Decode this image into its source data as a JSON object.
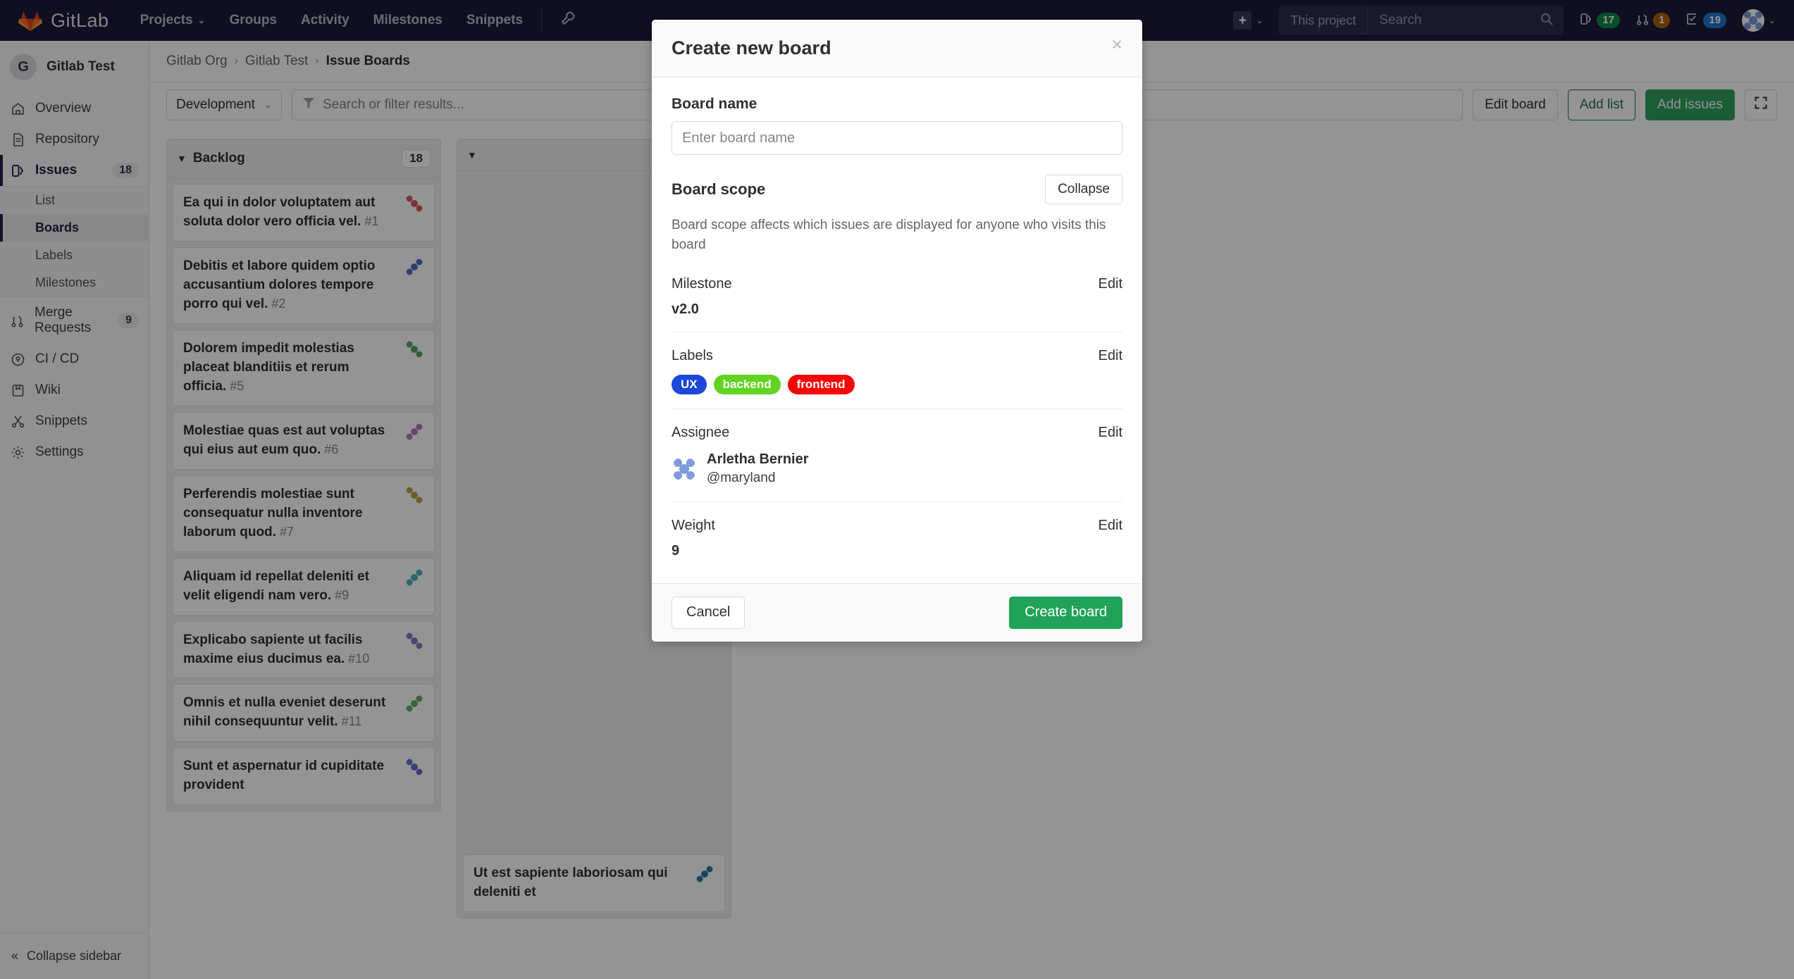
{
  "topnav": {
    "brand": "GitLab",
    "links": [
      {
        "label": "Projects",
        "has_caret": true
      },
      {
        "label": "Groups",
        "has_caret": false
      },
      {
        "label": "Activity",
        "has_caret": false
      },
      {
        "label": "Milestones",
        "has_caret": false
      },
      {
        "label": "Snippets",
        "has_caret": false
      }
    ],
    "search": {
      "scope": "This project",
      "placeholder": "Search"
    },
    "counters": [
      {
        "icon": "issues-icon",
        "count": "17",
        "color": "#108548"
      },
      {
        "icon": "merge-request-icon",
        "count": "1",
        "color": "#ab6100"
      },
      {
        "icon": "todos-icon",
        "count": "19",
        "color": "#1f75cb"
      }
    ]
  },
  "sidebar": {
    "project": {
      "initial": "G",
      "name": "Gitlab Test"
    },
    "items": [
      {
        "label": "Overview",
        "icon": "home-icon",
        "count": ""
      },
      {
        "label": "Repository",
        "icon": "document-icon",
        "count": ""
      },
      {
        "label": "Issues",
        "icon": "issues-icon",
        "count": "18"
      },
      {
        "label": "Merge Requests",
        "icon": "merge-request-icon",
        "count": "9"
      },
      {
        "label": "CI / CD",
        "icon": "rocket-icon",
        "count": ""
      },
      {
        "label": "Wiki",
        "icon": "book-icon",
        "count": ""
      },
      {
        "label": "Snippets",
        "icon": "scissors-icon",
        "count": ""
      },
      {
        "label": "Settings",
        "icon": "gear-icon",
        "count": ""
      }
    ],
    "issues_sub": [
      {
        "label": "List",
        "current": false
      },
      {
        "label": "Boards",
        "current": true
      },
      {
        "label": "Labels",
        "current": false
      },
      {
        "label": "Milestones",
        "current": false
      }
    ],
    "collapse_label": "Collapse sidebar"
  },
  "main": {
    "breadcrumb": [
      "Gitlab Org",
      "Gitlab Test",
      "Issue Boards"
    ],
    "toolbar": {
      "board_select": "Development",
      "filter_placeholder": "Search or filter results...",
      "edit_board": "Edit board",
      "add_list": "Add list",
      "add_issues": "Add issues",
      "fullscreen_icon": "expand-icon"
    },
    "lists": [
      {
        "title": "Backlog",
        "count": "18",
        "cards": [
          {
            "title": "Ea qui in dolor voluptatem aut soluta dolor vero officia vel.",
            "iid": "#1"
          },
          {
            "title": "Debitis et labore quidem optio accusantium dolores tempore porro qui vel.",
            "iid": "#2"
          },
          {
            "title": "Dolorem impedit molestias placeat blanditiis et rerum officia.",
            "iid": "#5"
          },
          {
            "title": "Molestiae quas est aut voluptas qui eius aut eum quo.",
            "iid": "#6"
          },
          {
            "title": "Perferendis molestiae sunt consequatur nulla inventore laborum quod.",
            "iid": "#7"
          },
          {
            "title": "Aliquam id repellat deleniti et velit eligendi nam vero.",
            "iid": "#9"
          },
          {
            "title": "Explicabo sapiente ut facilis maxime eius ducimus ea.",
            "iid": "#10"
          },
          {
            "title": "Omnis et nulla eveniet deserunt nihil consequuntur velit.",
            "iid": "#11"
          },
          {
            "title": "Sunt et aspernatur id cupiditate provident",
            "iid": ""
          }
        ]
      },
      {
        "title": "",
        "count": "",
        "cards": [
          {
            "title": "Ut est sapiente laboriosam qui deleniti et",
            "iid": ""
          }
        ]
      }
    ]
  },
  "modal": {
    "title": "Create new board",
    "close_icon": "close-icon",
    "board_name_label": "Board name",
    "board_name_value": "",
    "board_name_placeholder": "Enter board name",
    "scope_title": "Board scope",
    "collapse_label": "Collapse",
    "scope_description": "Board scope affects which issues are displayed for anyone who visits this board",
    "edit_label": "Edit",
    "blocks": [
      {
        "label": "Milestone",
        "value": "v2.0"
      },
      {
        "label": "Labels",
        "value": ""
      },
      {
        "label": "Assignee",
        "value": ""
      },
      {
        "label": "Weight",
        "value": "9"
      }
    ],
    "labels": [
      {
        "name": "UX",
        "color": "#1b48d8"
      },
      {
        "name": "backend",
        "color": "#60d420"
      },
      {
        "name": "frontend",
        "color": "#f40606"
      }
    ],
    "assignee": {
      "name": "Arletha Bernier",
      "username": "@maryland"
    },
    "cancel_label": "Cancel",
    "create_label": "Create board"
  },
  "colors": {
    "nav_bg": "#1b1b3a",
    "primary_green": "#20a358",
    "accent_dark": "#1f1f4a"
  }
}
